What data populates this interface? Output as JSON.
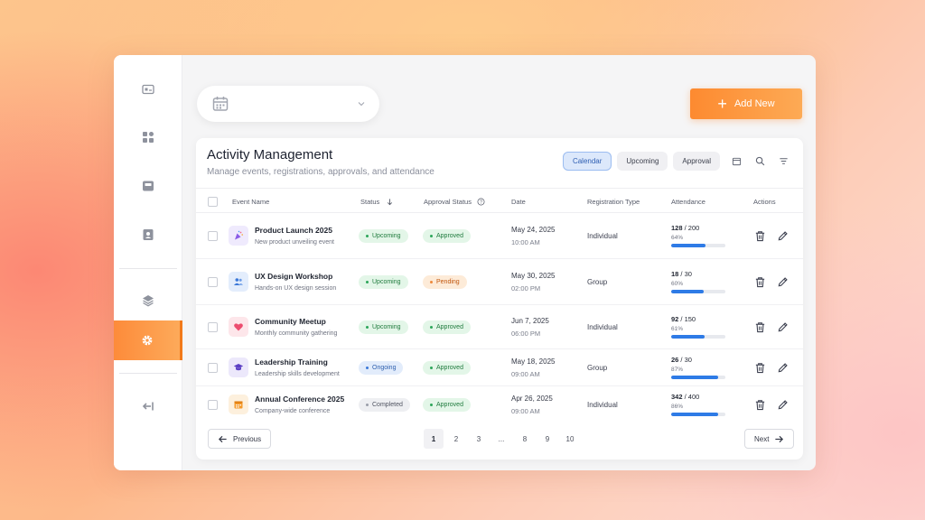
{
  "header": {
    "add_button_label": "Add New"
  },
  "card": {
    "title": "Activity Management",
    "subtitle": "Manage events, registrations, approvals, and attendance",
    "filters": [
      "Calendar",
      "Upcoming",
      "Approval"
    ]
  },
  "table": {
    "columns": [
      "Event Name",
      "Status",
      "Approval Status",
      "Date",
      "Registration Type",
      "Attendance",
      "Actions"
    ],
    "rows": [
      {
        "name": "Product Launch 2025",
        "desc": "New product unveiling event",
        "icon": "party-popper-icon",
        "status": "Upcoming",
        "approval": "Approved",
        "date": "May 24, 2025",
        "time": "10:00 AM",
        "reg_type": "Individual",
        "att_count": "128",
        "att_total": " / 200",
        "att_pct_label": "64%",
        "att_pct": 64
      },
      {
        "name": "UX Design Workshop",
        "desc": "Hands-on UX design session",
        "icon": "users-icon",
        "status": "Upcoming",
        "approval": "Pending",
        "date": "May 30, 2025",
        "time": "02:00 PM",
        "reg_type": "Group",
        "att_count": "18",
        "att_total": " / 30",
        "att_pct_label": "60%",
        "att_pct": 60
      },
      {
        "name": "Community Meetup",
        "desc": "Monthly community gathering",
        "icon": "heart-icon",
        "status": "Upcoming",
        "approval": "Approved",
        "date": "Jun 7, 2025",
        "time": "06:00 PM",
        "reg_type": "Individual",
        "att_count": "92",
        "att_total": " / 150",
        "att_pct_label": "61%",
        "att_pct": 61
      },
      {
        "name": "Leadership Training",
        "desc": "Leadership skills development",
        "icon": "graduation-cap-icon",
        "status": "Ongoing",
        "approval": "Approved",
        "date": "May 18, 2025",
        "time": "09:00 AM",
        "reg_type": "Group",
        "att_count": "26",
        "att_total": " / 30",
        "att_pct_label": "87%",
        "att_pct": 87
      },
      {
        "name": "Annual Conference 2025",
        "desc": "Company-wide conference",
        "icon": "calendar-icon",
        "status": "Completed",
        "approval": "Approved",
        "date": "Apr 26, 2025",
        "time": "09:00 AM",
        "reg_type": "Individual",
        "att_count": "342",
        "att_total": " / 400",
        "att_pct_label": "86%",
        "att_pct": 86
      }
    ]
  },
  "pagination": {
    "previous_label": "Previous",
    "next_label": "Next",
    "pages": [
      "1",
      "2",
      "3",
      "...",
      "8",
      "9",
      "10"
    ],
    "current": "1"
  },
  "colors": {
    "accent": "#fd8a30",
    "progress": "#2e7be6",
    "status_upcoming": "#1e7a3c",
    "status_ongoing": "#2d5fae",
    "status_completed": "#505461",
    "approval_pending": "#c2570e"
  }
}
